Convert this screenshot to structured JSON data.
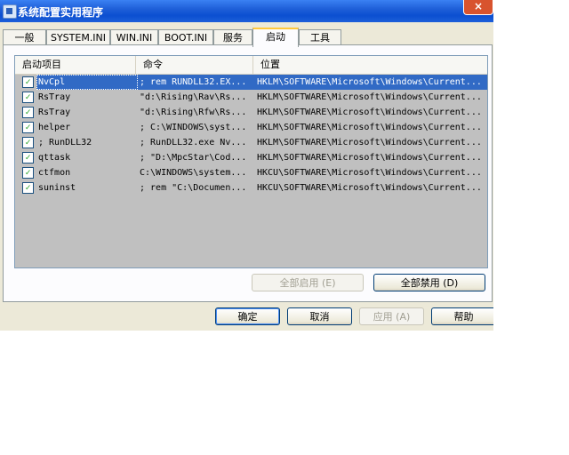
{
  "window": {
    "title": "系统配置实用程序",
    "close_label": "×"
  },
  "tabs": [
    "一般",
    "SYSTEM.INI",
    "WIN.INI",
    "BOOT.INI",
    "服务",
    "启动",
    "工具"
  ],
  "active_tab": "启动",
  "columns": [
    "启动项目",
    "命令",
    "位置"
  ],
  "rows": [
    {
      "name": "NvCpl",
      "command": "; rem RUNDLL32.EX...",
      "location": "HKLM\\SOFTWARE\\Microsoft\\Windows\\Current...",
      "checked": true,
      "selected": true
    },
    {
      "name": "RsTray",
      "command": "\"d:\\Rising\\Rav\\Rs...",
      "location": "HKLM\\SOFTWARE\\Microsoft\\Windows\\Current...",
      "checked": true,
      "selected": false
    },
    {
      "name": "RsTray",
      "command": "\"d:\\Rising\\Rfw\\Rs...",
      "location": "HKLM\\SOFTWARE\\Microsoft\\Windows\\Current...",
      "checked": true,
      "selected": false
    },
    {
      "name": "helper",
      "command": "; C:\\WINDOWS\\syst...",
      "location": "HKLM\\SOFTWARE\\Microsoft\\Windows\\Current...",
      "checked": true,
      "selected": false
    },
    {
      "name": "; RunDLL32",
      "command": "; RunDLL32.exe Nv...",
      "location": "HKLM\\SOFTWARE\\Microsoft\\Windows\\Current...",
      "checked": true,
      "selected": false
    },
    {
      "name": "qttask",
      "command": "; \"D:\\MpcStar\\Cod...",
      "location": "HKLM\\SOFTWARE\\Microsoft\\Windows\\Current...",
      "checked": true,
      "selected": false
    },
    {
      "name": "ctfmon",
      "command": "C:\\WINDOWS\\system...",
      "location": "HKCU\\SOFTWARE\\Microsoft\\Windows\\Current...",
      "checked": true,
      "selected": false
    },
    {
      "name": "suninst",
      "command": "; rem \"C:\\Documen...",
      "location": "HKCU\\SOFTWARE\\Microsoft\\Windows\\Current...",
      "checked": true,
      "selected": false
    }
  ],
  "check_mark": "✓",
  "buttons": {
    "enable_all": "全部启用 (E)",
    "disable_all": "全部禁用 (D)",
    "ok": "确定",
    "cancel": "取消",
    "apply": "应用 (A)",
    "help": "帮助"
  }
}
